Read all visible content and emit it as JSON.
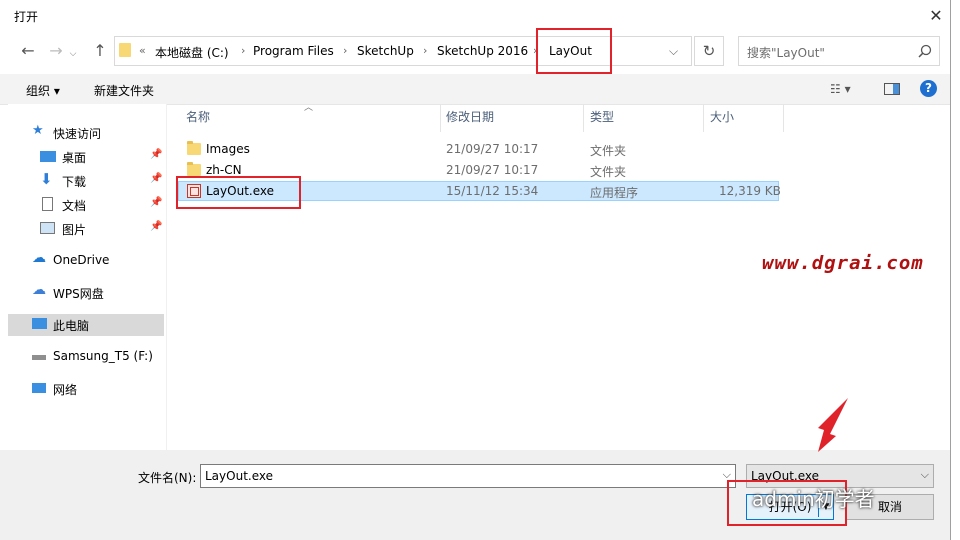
{
  "window": {
    "title": "打开",
    "close_glyph": "✕"
  },
  "nav_buttons": {
    "back": "←",
    "forward": "→",
    "up": "↑"
  },
  "address": {
    "overflow": "«",
    "crumbs": [
      "本地磁盘 (C:)",
      "Program Files",
      "SketchUp",
      "SketchUp 2016",
      "LayOut"
    ],
    "dropdown": "⌵",
    "refresh": "↻"
  },
  "search": {
    "placeholder": "搜索\"LayOut\"",
    "icon": "search-icon"
  },
  "toolbar": {
    "organize": "组织 ▾",
    "new_folder": "新建文件夹",
    "view_glyph": "☷ ▾",
    "help": "?"
  },
  "sidebar": {
    "items": [
      {
        "label": "快速访问",
        "icon": "star-icon"
      },
      {
        "label": "桌面",
        "icon": "desktop-icon",
        "pinned": true
      },
      {
        "label": "下载",
        "icon": "download-icon",
        "pinned": true
      },
      {
        "label": "文档",
        "icon": "document-icon",
        "pinned": true
      },
      {
        "label": "图片",
        "icon": "picture-icon",
        "pinned": true
      },
      {
        "label": "OneDrive",
        "icon": "cloud-icon"
      },
      {
        "label": "WPS网盘",
        "icon": "cloud-drive-icon"
      },
      {
        "label": "此电脑",
        "icon": "computer-icon",
        "selected": true
      },
      {
        "label": "Samsung_T5 (F:)",
        "icon": "drive-icon"
      },
      {
        "label": "网络",
        "icon": "network-icon"
      }
    ]
  },
  "columns": {
    "name": "名称",
    "date": "修改日期",
    "type": "类型",
    "size": "大小"
  },
  "files": [
    {
      "name": "Images",
      "date": "21/09/27 10:17",
      "type": "文件夹",
      "size": "",
      "kind": "folder"
    },
    {
      "name": "zh-CN",
      "date": "21/09/27 10:17",
      "type": "文件夹",
      "size": "",
      "kind": "folder"
    },
    {
      "name": "LayOut.exe",
      "date": "15/11/12 15:34",
      "type": "应用程序",
      "size": "12,319 KB",
      "kind": "exe",
      "selected": true
    }
  ],
  "filename": {
    "label": "文件名(N):",
    "value": "LayOut.exe"
  },
  "filetype": {
    "value": "LayOut.exe"
  },
  "buttons": {
    "open": "打开(O)",
    "cancel": "取消"
  },
  "watermarks": {
    "site": "www.dgrai.com",
    "wechat": "admin初学者"
  },
  "colors": {
    "highlight": "#e0232b",
    "selection": "#cce8ff"
  }
}
